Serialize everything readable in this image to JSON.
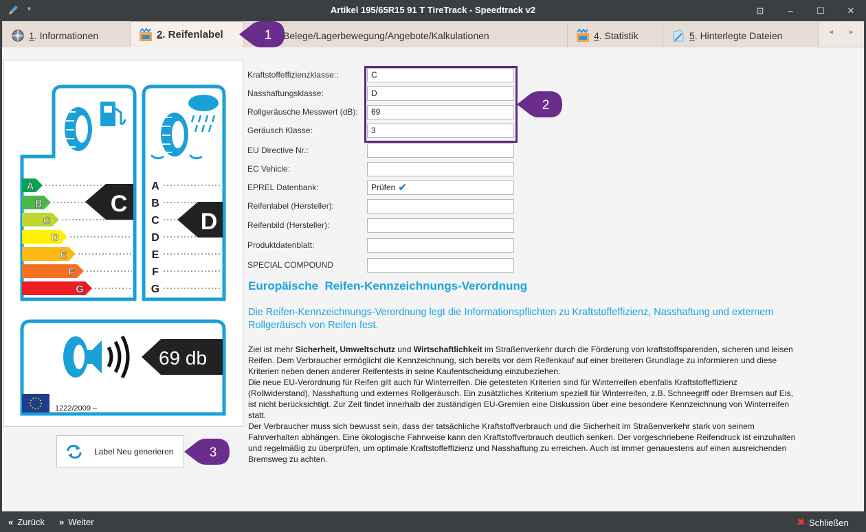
{
  "window": {
    "title": "Artikel 195/65R15 91 T TireTrack - Speedtrack v2",
    "controls": {
      "pin": "⊡",
      "minimize": "–",
      "maximize": "☐",
      "close": "✕"
    }
  },
  "tabs": [
    {
      "num": "1",
      "label": ". Informationen",
      "icon": "wheel-icon"
    },
    {
      "num": "2",
      "label": ". Reifenlabel",
      "icon": "tire-label-icon"
    },
    {
      "num": "",
      "label": "Belege/Lagerbewegung/Angebote/Kalkulationen",
      "icon": ""
    },
    {
      "num": "4",
      "label": ". Statistik",
      "icon": "chart-icon"
    },
    {
      "num": "5",
      "label": ". Hinterlegte Dateien",
      "icon": "file-icon"
    }
  ],
  "tab_nav": {
    "prev": "◂",
    "next": "▸"
  },
  "label": {
    "fuel_classes": [
      "A",
      "B",
      "C",
      "D",
      "E",
      "F",
      "G"
    ],
    "wet_classes": [
      "A",
      "B",
      "C",
      "D",
      "E",
      "F",
      "G"
    ],
    "fuel_value": "C",
    "wet_value": "D",
    "noise_value": "69 db",
    "regulation": "1222/2009 –",
    "class_colors": [
      "#00a651",
      "#4cb848",
      "#bed630",
      "#fff200",
      "#fdb913",
      "#f37021",
      "#ed1c24"
    ]
  },
  "regen_button": {
    "label": "Label Neu generieren",
    "icon": "refresh-icon"
  },
  "form": {
    "rows": [
      {
        "label": "Kraftstoffeffizienzklasse::",
        "value": "C"
      },
      {
        "label": "Nasshaftungsklasse:",
        "value": "D"
      },
      {
        "label": "Rollgeräusche Messwert (dB):",
        "value": "69"
      },
      {
        "label": "Geräusch Klasse:",
        "value": "3"
      },
      {
        "label": "EU Directive Nr.:",
        "value": ""
      },
      {
        "label": "EC Vehicle:",
        "value": ""
      },
      {
        "label": "EPREL Datenbank:",
        "value": "Prüfen"
      },
      {
        "label": "Reifenlabel (Hersteller):",
        "value": ""
      },
      {
        "label": "Reifenbild (Hersteller):",
        "value": ""
      },
      {
        "label": "Produktdatenblatt:",
        "value": ""
      },
      {
        "label": "SPECIAL COMPOUND",
        "value": ""
      }
    ]
  },
  "info": {
    "heading": "Europäische  Reifen-Kennzeichnungs-Verordnung",
    "lead": "Die Reifen-Kennzeichnungs-Verordnung legt die Informationspflichten zu Kraftstoffeffizienz, Nasshaftung und externem Rollgeräusch von Reifen fest.",
    "p1_a": "Ziel ist mehr ",
    "p1_b": "Sicherheit, Umweltschutz",
    "p1_c": " und ",
    "p1_d": "Wirtschaftlichkeit",
    "p1_e": " im Straßenverkehr durch die Förderung von kraftstoffsparenden, sicheren und leisen Reifen. Dem Verbraucher ermöglicht die Kennzeichnung, sich bereits vor dem Reifenkauf auf einer breiteren Grundlage zu informieren und diese Kriterien neben denen anderer Reifentests in seine Kaufentscheidung einzubeziehen.",
    "p2": "Die neue EU-Verordnung für Reifen gilt auch für Winterreifen. Die getesteten Kriterien sind für Winterreifen ebenfalls Kraftstoffeffizienz (Rollwiderstand), Nasshaftung und externes Rollgeräusch. Ein zusätzliches Kriterium speziell für Winterreifen, z.B. Schneegriff oder Bremsen auf Eis, ist nicht berücksichtigt. Zur Zeit findet innerhalb der zuständigen EU-Gremien eine Diskussion über eine besondere Kennzeichnung von Winterreifen statt.",
    "p3": "Der Verbraucher muss sich bewusst sein, dass der tatsächliche Kraftstoffverbrauch und die Sicherheit im Straßenverkehr stark von seinem Fahrverhalten abhängen. Eine ökologische Fahrweise kann den Kraftstoffverbrauch deutlich senken. Der vorgeschriebene Reifendruck ist einzuhalten und regelmäßig zu überprüfen, um optimale Kraftstoffeffizienz und Nasshaftung zu erreichen. Auch ist immer genauestens auf einen ausreichenden Bremsweg zu achten."
  },
  "callouts": [
    "1",
    "2",
    "3"
  ],
  "footer": {
    "back": "Zurück",
    "forward": "Weiter",
    "close": "Schließen"
  }
}
